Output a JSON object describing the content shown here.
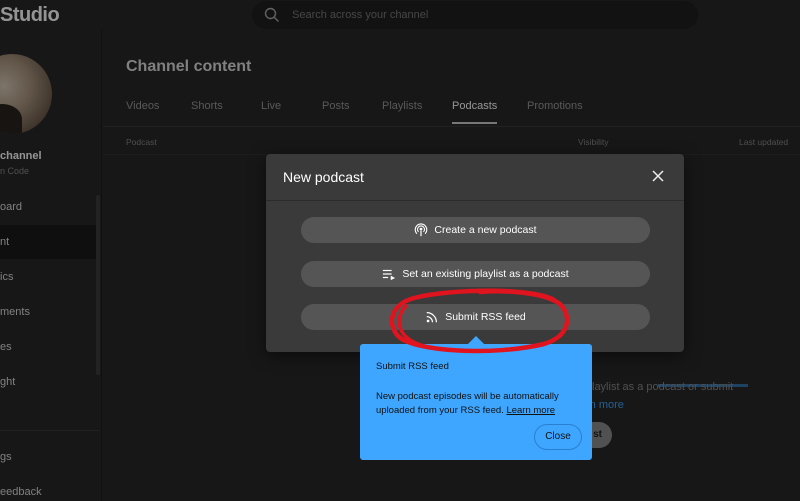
{
  "app": {
    "brand": "Studio"
  },
  "search": {
    "placeholder": "Search across your channel"
  },
  "sidebar": {
    "channel_name": "channel",
    "channel_sub": "n Code",
    "items": [
      {
        "label": "oard",
        "active": false
      },
      {
        "label": "nt",
        "active": true
      },
      {
        "label": "ics",
        "active": false
      },
      {
        "label": "ments",
        "active": false
      },
      {
        "label": "es",
        "active": false
      },
      {
        "label": "ght",
        "active": false
      },
      {
        "label": "gs",
        "active": false
      },
      {
        "label": "eedback",
        "active": false
      }
    ]
  },
  "main": {
    "title": "Channel content",
    "tabs": [
      {
        "label": "Videos",
        "active": false
      },
      {
        "label": "Shorts",
        "active": false
      },
      {
        "label": "Live",
        "active": false
      },
      {
        "label": "Posts",
        "active": false
      },
      {
        "label": "Playlists",
        "active": false
      },
      {
        "label": "Podcasts",
        "active": true
      },
      {
        "label": "Promotions",
        "active": false
      }
    ],
    "columns": {
      "podcast": "Podcast",
      "visibility": "Visibility",
      "last_updated": "Last updated"
    },
    "empty_text": "laylist as a podcast or submit",
    "empty_link": "rn more",
    "empty_button": "st"
  },
  "modal": {
    "title": "New podcast",
    "options": [
      {
        "label": "Create a new podcast",
        "icon": "podcast-icon"
      },
      {
        "label": "Set an existing playlist as a podcast",
        "icon": "playlist-play-icon"
      },
      {
        "label": "Submit RSS feed",
        "icon": "rss-icon"
      }
    ]
  },
  "tooltip": {
    "title": "Submit RSS feed",
    "body": "New podcast episodes will be automatically uploaded from your RSS feed.",
    "link": "Learn more",
    "close_label": "Close"
  },
  "colors": {
    "accent": "#3ea6ff",
    "annotation": "#e0141e",
    "modal_bg": "#3a3a3a"
  }
}
